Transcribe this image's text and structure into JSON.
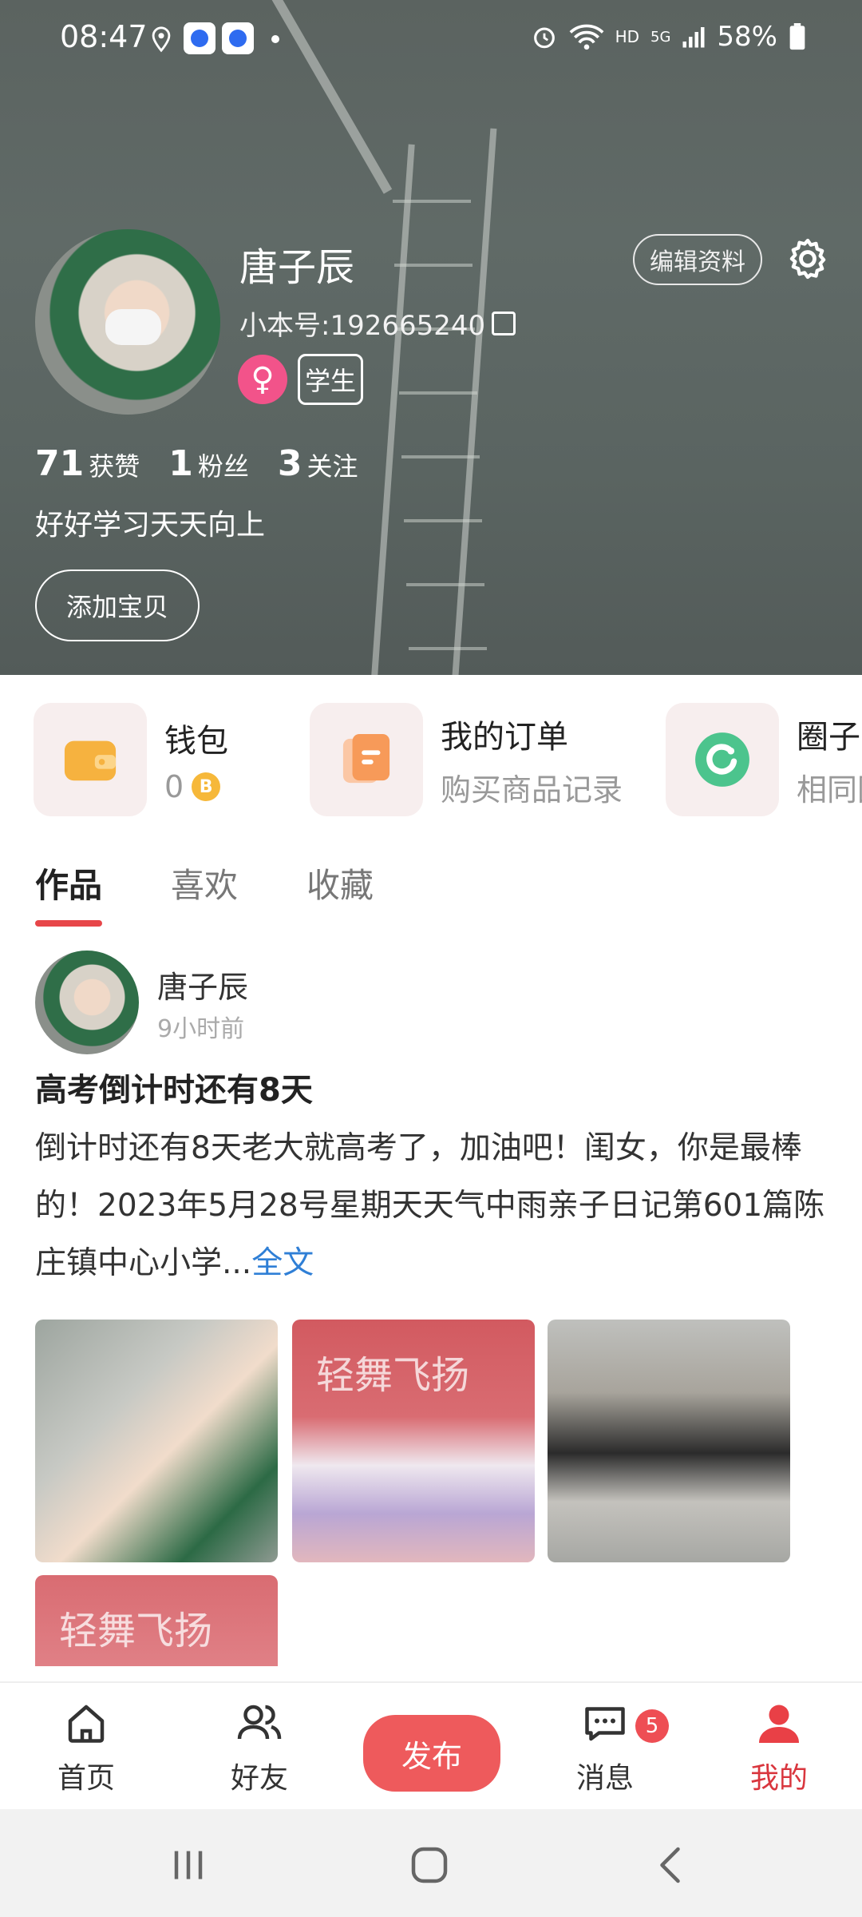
{
  "status_bar": {
    "time": "08:47",
    "network": "HD",
    "signal": "5G",
    "battery": "58%"
  },
  "profile": {
    "name": "唐子辰",
    "id_label": "小本号:192665240",
    "gender_symbol": "♀",
    "role": "学生",
    "edit_label": "编辑资料",
    "stats": [
      {
        "num": "71",
        "label": "获赞"
      },
      {
        "num": "1",
        "label": "粉丝"
      },
      {
        "num": "3",
        "label": "关注"
      }
    ],
    "bio": "好好学习天天向上",
    "add_label": "添加宝贝"
  },
  "cards": [
    {
      "title": "钱包",
      "sub": "0",
      "coin": "B"
    },
    {
      "title": "我的订单",
      "sub": "购买商品记录"
    },
    {
      "title": "圈子",
      "sub": "相同圈"
    }
  ],
  "tabs": [
    "作品",
    "喜欢",
    "收藏"
  ],
  "post": {
    "author": "唐子辰",
    "time": "9小时前",
    "title": "高考倒计时还有8天",
    "body": "倒计时还有8天老大就高考了，加油吧！闺女，你是最棒的！2023年5月28号星期天天气中雨亲子日记第601篇陈庄镇中心小学...",
    "more": "全文",
    "thumb_watermark": "轻舞飞扬"
  },
  "bottom_nav": {
    "home": "首页",
    "friends": "好友",
    "publish": "发布",
    "messages": "消息",
    "messages_badge": "5",
    "mine": "我的"
  },
  "colors": {
    "accent": "#ee5a5c",
    "active_tab_underline": "#e74649",
    "link": "#2f7fd6"
  }
}
